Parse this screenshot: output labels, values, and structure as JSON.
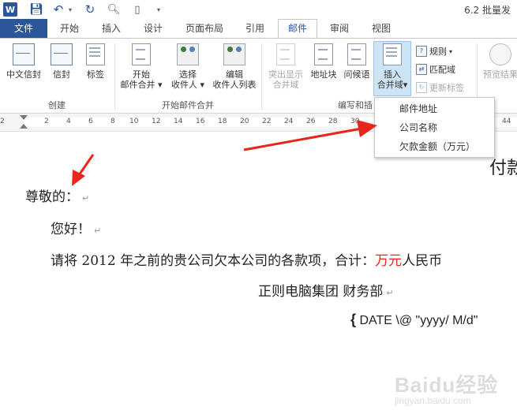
{
  "titlebar": {
    "app_logo": "W",
    "doc_title": "6.2 批量发",
    "icons": [
      "word-logo-icon",
      "save-icon",
      "undo-icon",
      "redo-icon",
      "print-preview-icon",
      "new-document-icon"
    ]
  },
  "tabs": [
    "文件",
    "开始",
    "插入",
    "设计",
    "页面布局",
    "引用",
    "邮件",
    "审阅",
    "视图"
  ],
  "active_tab": "邮件",
  "ribbon": {
    "create": {
      "label": "创建",
      "buttons": [
        "中文信封",
        "信封",
        "标签"
      ]
    },
    "start_merge": {
      "label": "开始邮件合并",
      "start_line1": "开始",
      "start_line2": "邮件合并",
      "select_line1": "选择",
      "select_line2": "收件人",
      "edit_line1": "编辑",
      "edit_line2": "收件人列表"
    },
    "write_insert": {
      "label": "编写和插",
      "highlight_line1": "突出显示",
      "highlight_line2": "合并域",
      "address_block": "地址块",
      "greeting_line": "问候语",
      "insert_line1": "插入",
      "insert_line2": "合并域",
      "rules": "规则",
      "match_fields": "匹配域",
      "update_labels": "更新标签"
    },
    "preview": {
      "preview_results": "预览结果"
    }
  },
  "ruler": {
    "numbers": [
      "2",
      "2",
      "4",
      "6",
      "8",
      "10",
      "12",
      "14",
      "16",
      "18",
      "20",
      "22",
      "24",
      "26",
      "28",
      "30",
      "44"
    ]
  },
  "dropdown": {
    "items": [
      "邮件地址",
      "公司名称",
      "欠款金额（万元）"
    ]
  },
  "document": {
    "right_cut": "付款",
    "salutation": "尊敬的：",
    "greeting": "您好！",
    "body_prefix": "请将 2012 年之前的贵公司欠本公司的各款项，合计：",
    "body_red": "万元",
    "body_suffix": "人民币",
    "signature": "正则电脑集团  财务部",
    "date_field_open": "{",
    "date_field": " DATE \\@ \"yyyy/ M/d\"",
    "para_mark": "↵"
  },
  "watermark": {
    "brand": "Baidu经验",
    "url": "jingyan.baidu.com"
  },
  "colors": {
    "accent": "#2b579a",
    "arrow": "#e8261a",
    "highlight": "#cde3f6"
  }
}
